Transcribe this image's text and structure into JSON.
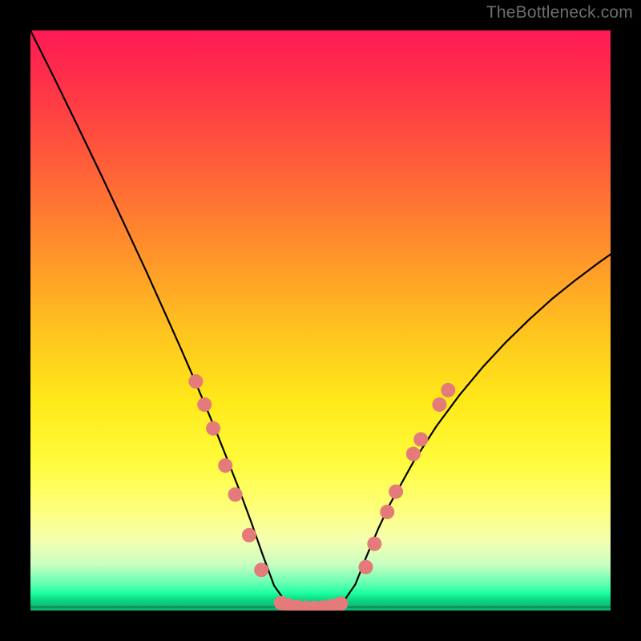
{
  "watermark": {
    "text": "TheBottleneck.com"
  },
  "colors": {
    "curve_stroke": "#000000",
    "marker_fill": "#e47a7a",
    "marker_stroke": "#d86a6a"
  },
  "chart_data": {
    "type": "line",
    "title": "",
    "xlabel": "",
    "ylabel": "",
    "xlim": [
      0,
      100
    ],
    "ylim": [
      0,
      100
    ],
    "grid": false,
    "series": [
      {
        "name": "bottleneck-curve",
        "x": [
          0,
          4,
          8,
          12,
          16,
          20,
          24,
          26,
          28,
          30,
          32,
          34,
          36,
          38,
          40,
          42,
          44,
          46,
          48,
          50,
          52,
          54,
          56,
          58,
          60,
          62,
          66,
          70,
          74,
          78,
          82,
          86,
          90,
          94,
          98,
          100
        ],
        "y": [
          100,
          92,
          83.8,
          75.5,
          67,
          58.4,
          49.5,
          45,
          40.4,
          35.7,
          30.9,
          25.9,
          20.8,
          15.4,
          9.7,
          4.3,
          1.5,
          0.6,
          0.4,
          0.4,
          0.6,
          1.6,
          4.5,
          9.5,
          14.2,
          18.4,
          25.6,
          31.8,
          37.2,
          42.0,
          46.3,
          50.2,
          53.8,
          57.0,
          60.0,
          61.4
        ]
      }
    ],
    "markers": {
      "name": "highlighted-points",
      "points": [
        {
          "x": 28.5,
          "y": 39.5
        },
        {
          "x": 30.0,
          "y": 35.5
        },
        {
          "x": 31.5,
          "y": 31.4
        },
        {
          "x": 33.6,
          "y": 25.0
        },
        {
          "x": 35.3,
          "y": 20.0
        },
        {
          "x": 37.7,
          "y": 13.0
        },
        {
          "x": 39.8,
          "y": 7.0
        },
        {
          "x": 43.2,
          "y": 1.3
        },
        {
          "x": 44.5,
          "y": 0.9
        },
        {
          "x": 46.0,
          "y": 0.6
        },
        {
          "x": 47.5,
          "y": 0.5
        },
        {
          "x": 49.0,
          "y": 0.45
        },
        {
          "x": 50.5,
          "y": 0.55
        },
        {
          "x": 52.0,
          "y": 0.8
        },
        {
          "x": 53.5,
          "y": 1.2
        },
        {
          "x": 57.8,
          "y": 7.5
        },
        {
          "x": 59.3,
          "y": 11.5
        },
        {
          "x": 61.5,
          "y": 17.0
        },
        {
          "x": 63.0,
          "y": 20.5
        },
        {
          "x": 66.0,
          "y": 27.0
        },
        {
          "x": 67.3,
          "y": 29.5
        },
        {
          "x": 70.5,
          "y": 35.5
        },
        {
          "x": 72.0,
          "y": 38.0
        }
      ]
    }
  }
}
